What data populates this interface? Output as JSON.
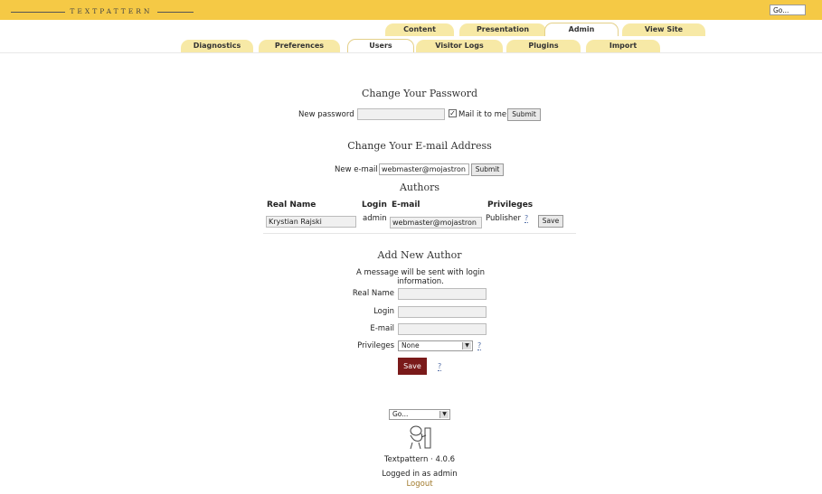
{
  "brand": "Textpattern",
  "top_go": "Go...",
  "tabs_primary": [
    "Content",
    "Presentation",
    "Admin",
    "View Site"
  ],
  "tabs_secondary": [
    "Diagnostics",
    "Preferences",
    "Users",
    "Visitor Logs",
    "Plugins",
    "Import"
  ],
  "password": {
    "heading": "Change Your Password",
    "label": "New password",
    "value": "",
    "mail_label": "Mail it to me",
    "mail_checked": true,
    "submit": "Submit"
  },
  "email": {
    "heading": "Change Your E-mail Address",
    "label": "New e-mail",
    "value": "webmaster@mojastron",
    "submit": "Submit"
  },
  "authors": {
    "heading": "Authors",
    "columns": [
      "Real Name",
      "Login",
      "E-mail",
      "Privileges"
    ],
    "rows": [
      {
        "real_name": "Krystian Rajski",
        "login": "admin",
        "email": "webmaster@mojastron",
        "privileges": "Publisher",
        "help": "?",
        "save": "Save"
      }
    ]
  },
  "add_author": {
    "heading": "Add New Author",
    "note": "A message will be sent with login information.",
    "real_name_label": "Real Name",
    "login_label": "Login",
    "email_label": "E-mail",
    "privileges_label": "Privileges",
    "privileges_value": "None",
    "help": "?",
    "save": "Save"
  },
  "footer": {
    "go": "Go...",
    "version": "Textpattern · 4.0.6",
    "logged_in": "Logged in as admin",
    "logout": "Logout"
  },
  "colors": {
    "accent": "#f5c945",
    "tab": "#f7e9a6",
    "save_button": "#7a1a1a",
    "link": "#a0792a"
  }
}
